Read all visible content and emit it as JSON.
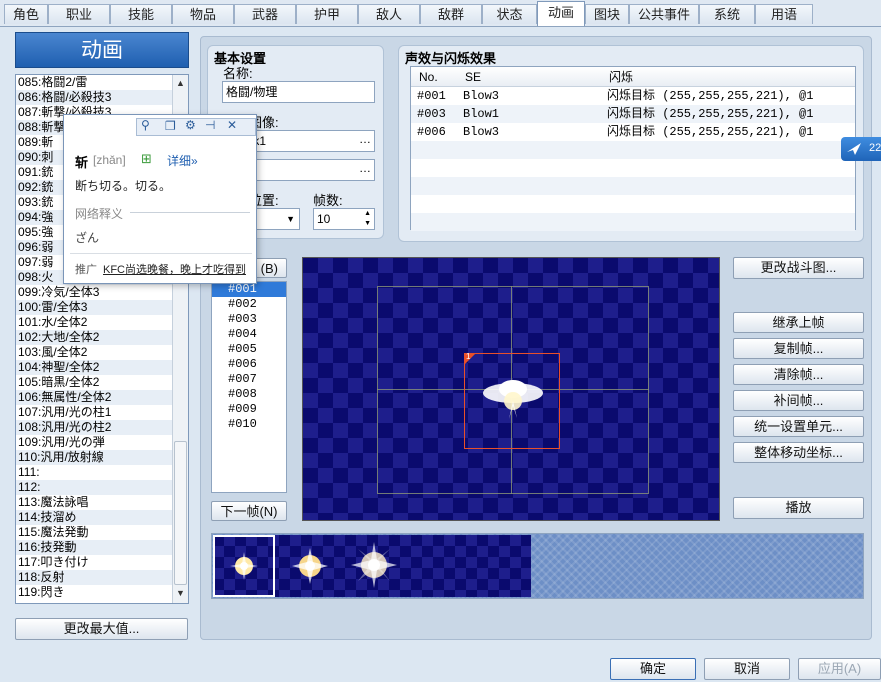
{
  "tabs": [
    "角色",
    "职业",
    "技能",
    "物品",
    "武器",
    "护甲",
    "敌人",
    "敌群",
    "状态",
    "动画",
    "图块",
    "公共事件",
    "系统",
    "用语"
  ],
  "active_tab": "动画",
  "banner": "动画",
  "anim_list": [
    "085:格闘2/雷",
    "086:格闘/必殺技3",
    "087:斬撃/必殺技3",
    "088:斬撃/必殺技4",
    "089:斬",
    "090:刺",
    "091:銃",
    "092:銃",
    "093:銃",
    "094:強",
    "095:強",
    "096:弱",
    "097:弱",
    "098:火",
    "099:冷気/全体3",
    "100:雷/全体3",
    "101:水/全体2",
    "102:大地/全体2",
    "103:風/全体2",
    "104:神聖/全体2",
    "105:暗黒/全体2",
    "106:無属性/全体2",
    "107:汎用/光の柱1",
    "108:汎用/光の柱2",
    "109:汎用/光の弾",
    "110:汎用/放射線",
    "111:",
    "112:",
    "113:魔法詠唱",
    "114:技溜め",
    "115:魔法発動",
    "116:技発動",
    "117:叩き付け",
    "118:反射",
    "119:閃き"
  ],
  "change_max_button": "更改最大值...",
  "basic": {
    "title": "基本设置",
    "name_label": "名称:",
    "name_value": "格闘/物理",
    "image_label": "动画图像:",
    "image1_value": "Attack1",
    "image2_value": "",
    "position_label": "显示位置:",
    "position_value": "",
    "frames_label": "帧数:",
    "frames_value": "10"
  },
  "se": {
    "title": "声效与闪烁效果",
    "headers": [
      "No.",
      "SE",
      "闪烁"
    ],
    "rows": [
      {
        "no": "#001",
        "se": "Blow3",
        "flash": "闪烁目标 (255,255,255,221), @1"
      },
      {
        "no": "#003",
        "se": "Blow1",
        "flash": "闪烁目标 (255,255,255,221), @1"
      },
      {
        "no": "#006",
        "se": "Blow3",
        "flash": "闪烁目标 (255,255,255,221), @1"
      }
    ]
  },
  "prev_frame_label": "(B)",
  "next_frame_button": "下一帧(N)",
  "frames": [
    "#001",
    "#002",
    "#003",
    "#004",
    "#005",
    "#006",
    "#007",
    "#008",
    "#009",
    "#010"
  ],
  "selected_frame": "#001",
  "cell_number": "1",
  "right_buttons": {
    "change_battle_bg": "更改战斗图...",
    "inherit_prev": "继承上帧",
    "copy_frame": "复制帧...",
    "clear_frame": "清除帧...",
    "tween": "补间帧...",
    "batch_set": "统一设置单元...",
    "move_all": "整体移动坐标...",
    "play": "播放"
  },
  "popup": {
    "word": "斩",
    "pinyin": "[zhǎn]",
    "detail": "详细»",
    "definition": "断ち切る。切る。",
    "net_label": "网络释义",
    "net_value": "ざん",
    "ad_prefix": "推广",
    "ad_text": "KFC尚选晚餐，晚上才吃得到"
  },
  "side_badge": "22",
  "footer": {
    "ok": "确定",
    "cancel": "取消",
    "apply": "应用(A)"
  },
  "colors": {
    "accent": "#2f7ad9",
    "banner": "#1f5fb0",
    "canvas_dark": "#0a0a6e",
    "canvas_light": "#1e1e8c"
  }
}
